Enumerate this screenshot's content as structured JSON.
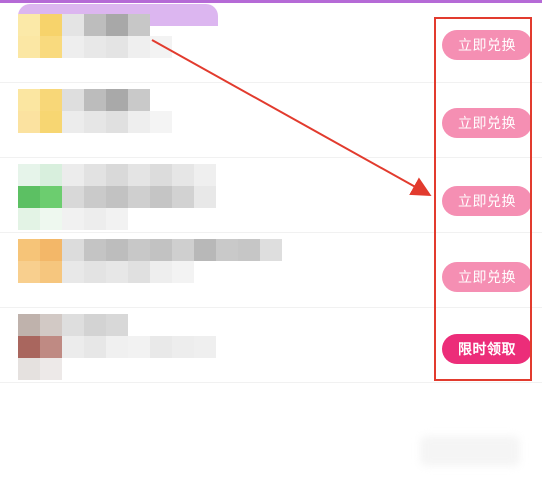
{
  "colors": {
    "accent_purple": "#b56ad6",
    "redeem_pink": "#f58fb3",
    "claim_magenta": "#ec2d79",
    "annotation_red": "#e23b2e"
  },
  "list": {
    "items": [
      {
        "button_label": "立即兑换",
        "button_type": "redeem"
      },
      {
        "button_label": "立即兑换",
        "button_type": "redeem"
      },
      {
        "button_label": "立即兑换",
        "button_type": "redeem"
      },
      {
        "button_label": "立即兑换",
        "button_type": "redeem"
      },
      {
        "button_label": "限时领取",
        "button_type": "claim"
      }
    ]
  }
}
